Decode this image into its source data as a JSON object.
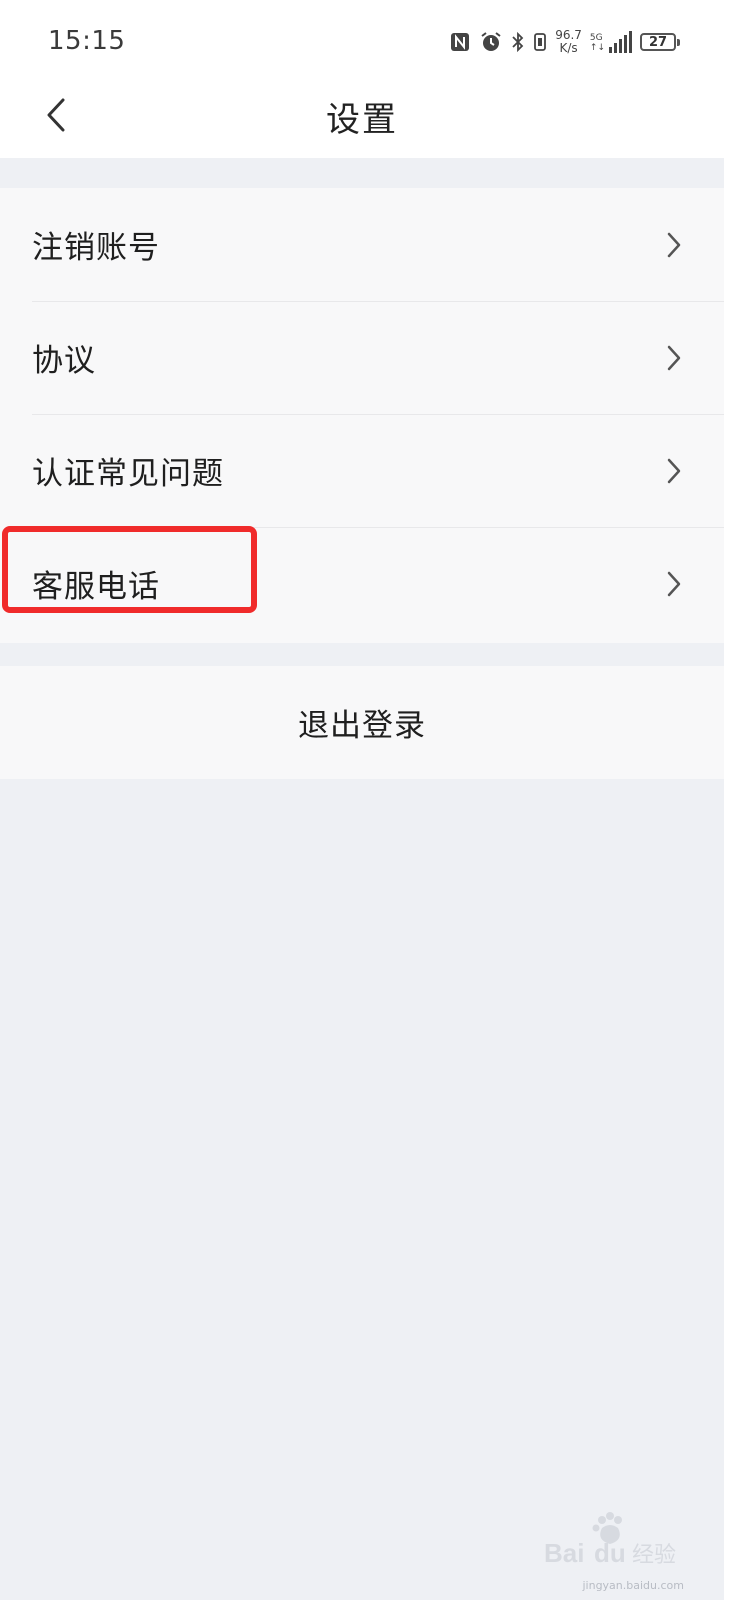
{
  "status_bar": {
    "time": "15:15",
    "net_speed_value": "96.7",
    "net_speed_unit": "K/s",
    "network_type": "5G",
    "battery": "27",
    "icons": [
      "nfc-icon",
      "alarm-icon",
      "bluetooth-icon",
      "vibrate-icon",
      "signal-icon",
      "battery-icon"
    ]
  },
  "header": {
    "title": "设置",
    "back_icon": "chevron-left-icon"
  },
  "settings": {
    "items": [
      {
        "label": "注销账号"
      },
      {
        "label": "协议"
      },
      {
        "label": "认证常见问题"
      },
      {
        "label": "客服电话"
      }
    ]
  },
  "logout": {
    "label": "退出登录"
  },
  "annotation": {
    "highlight_color": "#f02b2b",
    "highlighted_item": "客服电话"
  },
  "watermark": {
    "text": "Bai du 经验",
    "sub": "jingyan.baidu.com"
  },
  "colors": {
    "background": "#eef0f4",
    "card": "#f8f8f9",
    "bar": "#ffffff"
  }
}
